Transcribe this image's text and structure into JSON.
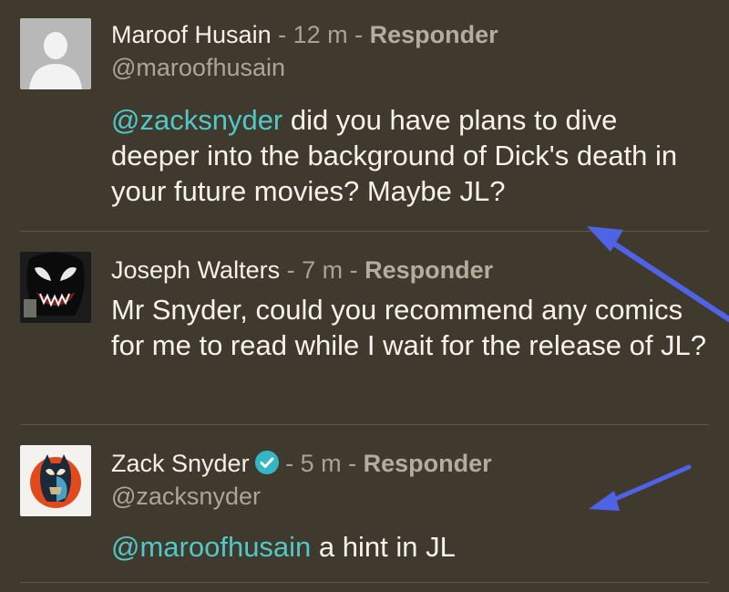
{
  "comments": [
    {
      "name": "Maroof Husain",
      "sep1": " - ",
      "time": "12 m",
      "sep2": " - ",
      "reply": "Responder",
      "handle": "@maroofhusain",
      "mention": "@zacksnyder",
      "text": " did you have plans to dive deeper into the background of Dick's death in your future movies? Maybe JL?"
    },
    {
      "name": "Joseph Walters",
      "sep1": " - ",
      "time": "7 m",
      "sep2": " - ",
      "reply": "Responder",
      "text": "Mr Snyder, could you recommend any comics for me to read while I wait for the release of JL?"
    },
    {
      "name": "Zack Snyder",
      "sep1": " - ",
      "time": "5 m",
      "sep2": " - ",
      "reply": "Responder",
      "handle": "@zacksnyder",
      "mention": "@maroofhusain",
      "text": " a hint in JL"
    }
  ],
  "colors": {
    "background": "#3f3a2d",
    "mention": "#52c7c7",
    "arrow": "#4f63e6",
    "verified": "#35b6c7"
  },
  "icons": [
    "default-avatar-icon",
    "verified-badge-icon",
    "annotation-arrow"
  ]
}
